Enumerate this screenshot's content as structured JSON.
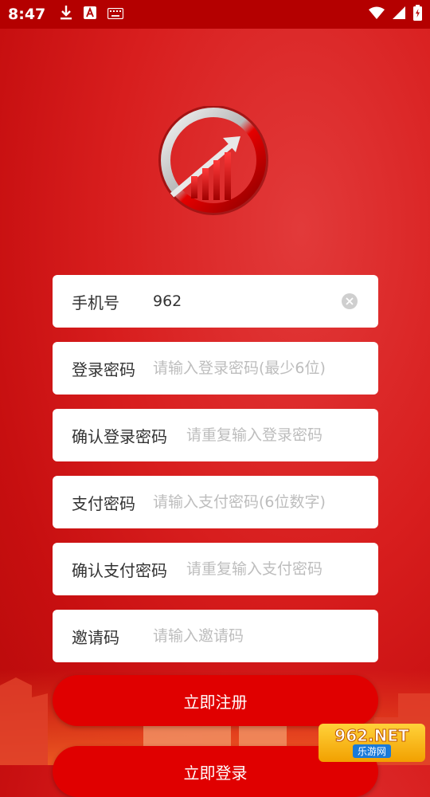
{
  "status_bar": {
    "time": "8:47"
  },
  "form": {
    "phone": {
      "label": "手机号",
      "value": "962"
    },
    "login_password": {
      "label": "登录密码",
      "placeholder": "请输入登录密码(最少6位)"
    },
    "confirm_login_password": {
      "label": "确认登录密码",
      "placeholder": "请重复输入登录密码"
    },
    "pay_password": {
      "label": "支付密码",
      "placeholder": "请输入支付密码(6位数字)"
    },
    "confirm_pay_password": {
      "label": "确认支付密码",
      "placeholder": "请重复输入支付密码"
    },
    "invite_code": {
      "label": "邀请码",
      "placeholder": "请输入邀请码"
    }
  },
  "buttons": {
    "register": "立即注册",
    "login": "立即登录"
  },
  "watermark": {
    "top": "962.NET",
    "bottom": "乐游网"
  },
  "colors": {
    "background": "#d81e1e",
    "status_bar": "#b40000",
    "button": "#e00000",
    "placeholder": "#bdbdbd"
  }
}
